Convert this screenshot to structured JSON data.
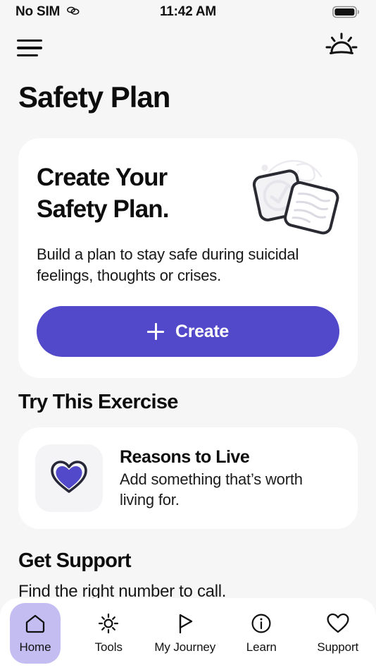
{
  "status_bar": {
    "carrier": "No SIM",
    "link_icon": "chain-link-icon",
    "time": "11:42 AM",
    "battery_icon": "battery-full-icon"
  },
  "app_bar": {
    "menu_icon": "hamburger-menu-icon",
    "theme_icon": "sunrise-icon"
  },
  "page": {
    "title": "Safety Plan"
  },
  "hero": {
    "title": "Create Your\nSafety Plan.",
    "body": "Build a plan to stay safe during suicidal\nfeelings, thoughts or crises.",
    "illustration_icon": "notes-cards-illustration",
    "button_label": "Create",
    "button_icon": "plus-icon",
    "button_color": "#5149c9"
  },
  "exercise_section": {
    "heading": "Try This Exercise",
    "item": {
      "icon": "heart-icon",
      "icon_color": "#5149c9",
      "title": "Reasons to Live",
      "subtitle": "Add something that’s worth\nliving for."
    }
  },
  "support_section": {
    "heading": "Get Support",
    "subtitle": "Find the right number to call."
  },
  "bottom_nav": {
    "items": [
      {
        "label": "Home",
        "icon": "home-icon",
        "active": true
      },
      {
        "label": "Tools",
        "icon": "sun-icon",
        "active": false
      },
      {
        "label": "My Journey",
        "icon": "flag-icon",
        "active": false
      },
      {
        "label": "Learn",
        "icon": "info-circle-icon",
        "active": false
      },
      {
        "label": "Support",
        "icon": "heart-outline-icon",
        "active": false
      }
    ],
    "active_pill_color": "#c3bdf2"
  }
}
